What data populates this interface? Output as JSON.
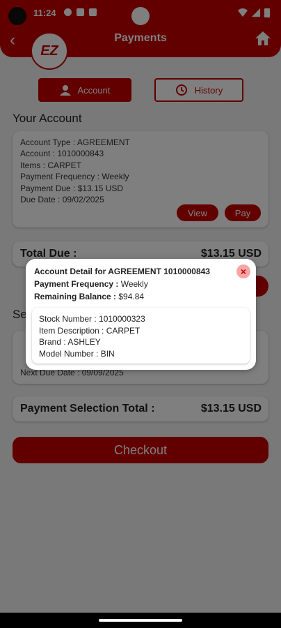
{
  "status": {
    "time": "11:24"
  },
  "header": {
    "title": "Payments",
    "logo_text": "EZ"
  },
  "tabs": [
    {
      "label": "Account"
    },
    {
      "label": "History"
    }
  ],
  "your_account": {
    "title": "Your Account",
    "lines": [
      {
        "label": "Account Type : ",
        "value": "AGREEMENT"
      },
      {
        "label": "Account : ",
        "value": "1010000843"
      },
      {
        "label": "Items : ",
        "value": "CARPET"
      },
      {
        "label": "Payment Frequency : ",
        "value": "Weekly"
      },
      {
        "label": "Payment Due : ",
        "value": "$13.15 USD"
      },
      {
        "label": "Due Date : ",
        "value": "09/02/2025"
      }
    ],
    "view_label": "View",
    "pay_label": "Pay"
  },
  "total_due": {
    "label": "Total Due :",
    "value": "$13.15 USD"
  },
  "selection": {
    "title_partial": "Se",
    "next_due": "Next Due Date : 09/09/2025"
  },
  "payment_total": {
    "label": "Payment Selection Total :",
    "value": "$13.15 USD"
  },
  "checkout_label": "Checkout",
  "modal": {
    "title": "Account Detail for  AGREEMENT 1010000843",
    "frequency_label": "Payment Frequency : ",
    "frequency_value": "Weekly",
    "balance_label": "Remaining Balance : ",
    "balance_value": "$94.84",
    "stock": "Stock Number : 1010000323",
    "item_desc": "Item Description : CARPET",
    "brand": "Brand : ASHLEY",
    "model": "Model Number : BIN"
  },
  "colors": {
    "brand": "#c40000"
  }
}
